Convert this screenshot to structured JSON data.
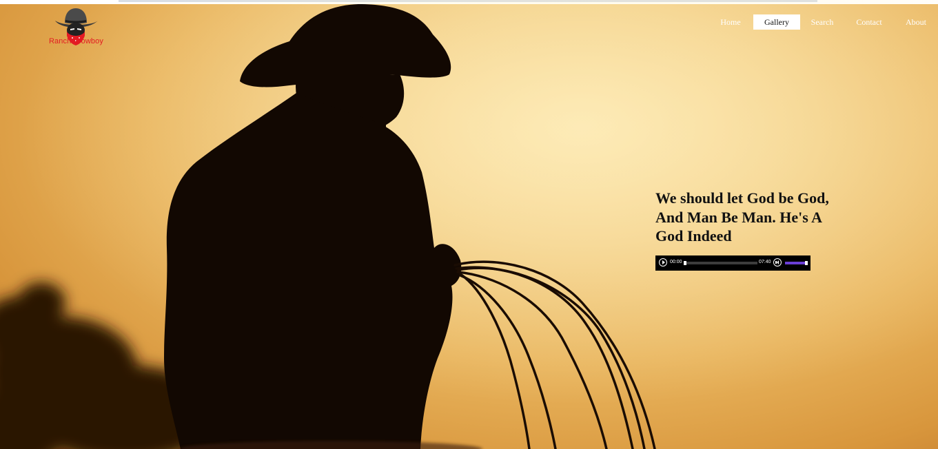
{
  "logo": {
    "text": "Ranch  Cowboy",
    "accent_color": "#e31b23"
  },
  "nav": {
    "items": [
      {
        "label": "Home",
        "active": false
      },
      {
        "label": "Gallery",
        "active": true
      },
      {
        "label": "Search",
        "active": false
      },
      {
        "label": "Contact",
        "active": false
      },
      {
        "label": "About",
        "active": false
      }
    ]
  },
  "hero": {
    "quote": "We should let God be God, And Man Be Man. He's A God Indeed"
  },
  "audio_player": {
    "current_time": "00:00",
    "duration": "07:40",
    "progress": 0.0,
    "volume": 1.0,
    "play_icon": "play-icon",
    "volume_icon": "volume-icon",
    "volume_color": "#6a3fd6"
  }
}
